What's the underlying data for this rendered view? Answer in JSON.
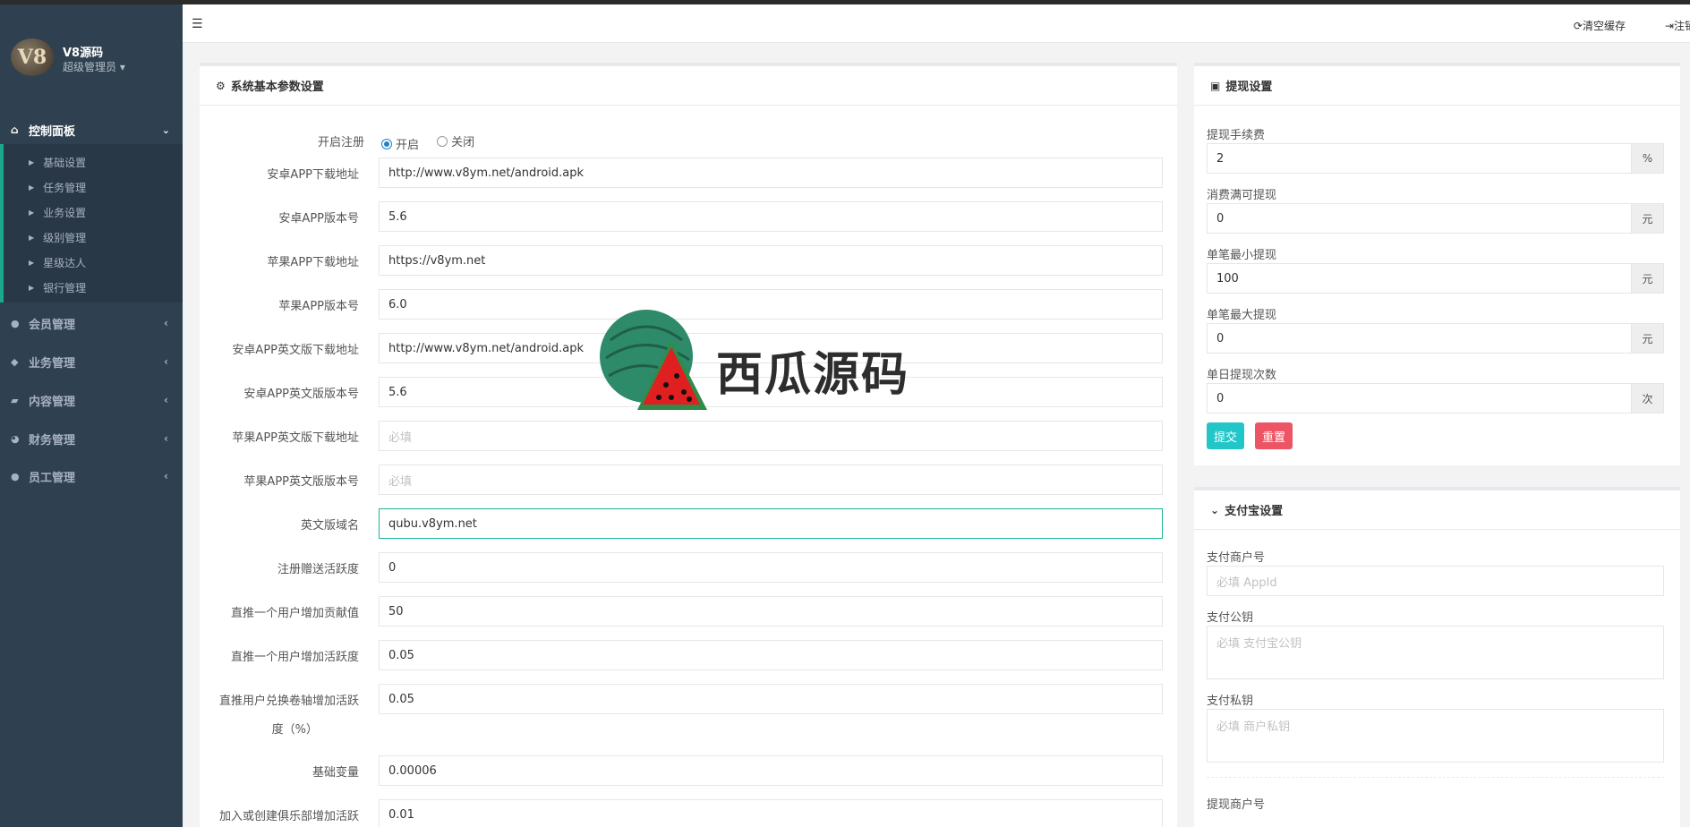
{
  "sidebar": {
    "logo_text": "V8",
    "brand": "V8源码",
    "role": "超级管理员 ▾",
    "main": {
      "label": "控制面板"
    },
    "sub_items": [
      {
        "label": "基础设置"
      },
      {
        "label": "任务管理"
      },
      {
        "label": "业务设置"
      },
      {
        "label": "级别管理"
      },
      {
        "label": "星级达人"
      },
      {
        "label": "银行管理"
      }
    ],
    "groups": [
      {
        "label": "会员管理",
        "icon": "user-icon"
      },
      {
        "label": "业务管理",
        "icon": "flask-icon"
      },
      {
        "label": "内容管理",
        "icon": "book-icon"
      },
      {
        "label": "财务管理",
        "icon": "pie-chart-icon"
      },
      {
        "label": "员工管理",
        "icon": "user-icon"
      }
    ]
  },
  "topbar": {
    "clear_cache": "清空缓存",
    "logout": "注销"
  },
  "system_panel": {
    "title": "系统基本参数设置",
    "register": {
      "label": "开启注册",
      "options": [
        "开启",
        "关闭"
      ],
      "selected": "开启"
    },
    "fields": [
      {
        "label": "安卓APP下载地址",
        "value": "http://www.v8ym.net/android.apk",
        "placeholder": ""
      },
      {
        "label": "安卓APP版本号",
        "value": "5.6",
        "placeholder": ""
      },
      {
        "label": "苹果APP下载地址",
        "value": "https://v8ym.net",
        "placeholder": ""
      },
      {
        "label": "苹果APP版本号",
        "value": "6.0",
        "placeholder": ""
      },
      {
        "label": "安卓APP英文版下载地址",
        "value": "http://www.v8ym.net/android.apk",
        "placeholder": ""
      },
      {
        "label": "安卓APP英文版版本号",
        "value": "5.6",
        "placeholder": ""
      },
      {
        "label": "苹果APP英文版下载地址",
        "value": "",
        "placeholder": "必填"
      },
      {
        "label": "苹果APP英文版版本号",
        "value": "",
        "placeholder": "必填"
      },
      {
        "label": "英文版域名",
        "value": "qubu.v8ym.net",
        "placeholder": ""
      },
      {
        "label": "注册赠送活跃度",
        "value": "0",
        "placeholder": ""
      },
      {
        "label": "直推一个用户增加贡献值",
        "value": "50",
        "placeholder": ""
      },
      {
        "label": "直推一个用户增加活跃度",
        "value": "0.05",
        "placeholder": ""
      },
      {
        "label": "直推用户兑换卷轴增加活跃",
        "label2": "度（%）",
        "value": "0.05",
        "placeholder": ""
      },
      {
        "label": "基础变量",
        "value": "0.00006",
        "placeholder": ""
      },
      {
        "label": "加入或创建俱乐部增加活跃",
        "value": "0.01",
        "placeholder": ""
      }
    ]
  },
  "withdraw_panel": {
    "title": "提现设置",
    "fields": [
      {
        "label": "提现手续费",
        "value": "2",
        "addon": "%"
      },
      {
        "label": "消费满可提现",
        "value": "0",
        "addon": "元"
      },
      {
        "label": "单笔最小提现",
        "value": "100",
        "addon": "元"
      },
      {
        "label": "单笔最大提现",
        "value": "0",
        "addon": "元"
      },
      {
        "label": "单日提现次数",
        "value": "0",
        "addon": "次"
      }
    ],
    "submit": "提交",
    "reset": "重置",
    "submit_color": "#23c6c8",
    "reset_color": "#ed5565"
  },
  "alipay_panel": {
    "title": "支付宝设置",
    "merchant_label": "支付商户号",
    "merchant_placeholder": "必填 AppId",
    "pubkey_label": "支付公钥",
    "pubkey_placeholder": "必填 支付宝公钥",
    "privkey_label": "支付私钥",
    "privkey_placeholder": "必填 商户私钥",
    "withdraw_merchant_label": "提现商户号"
  },
  "watermark": {
    "text": "西瓜源码"
  }
}
